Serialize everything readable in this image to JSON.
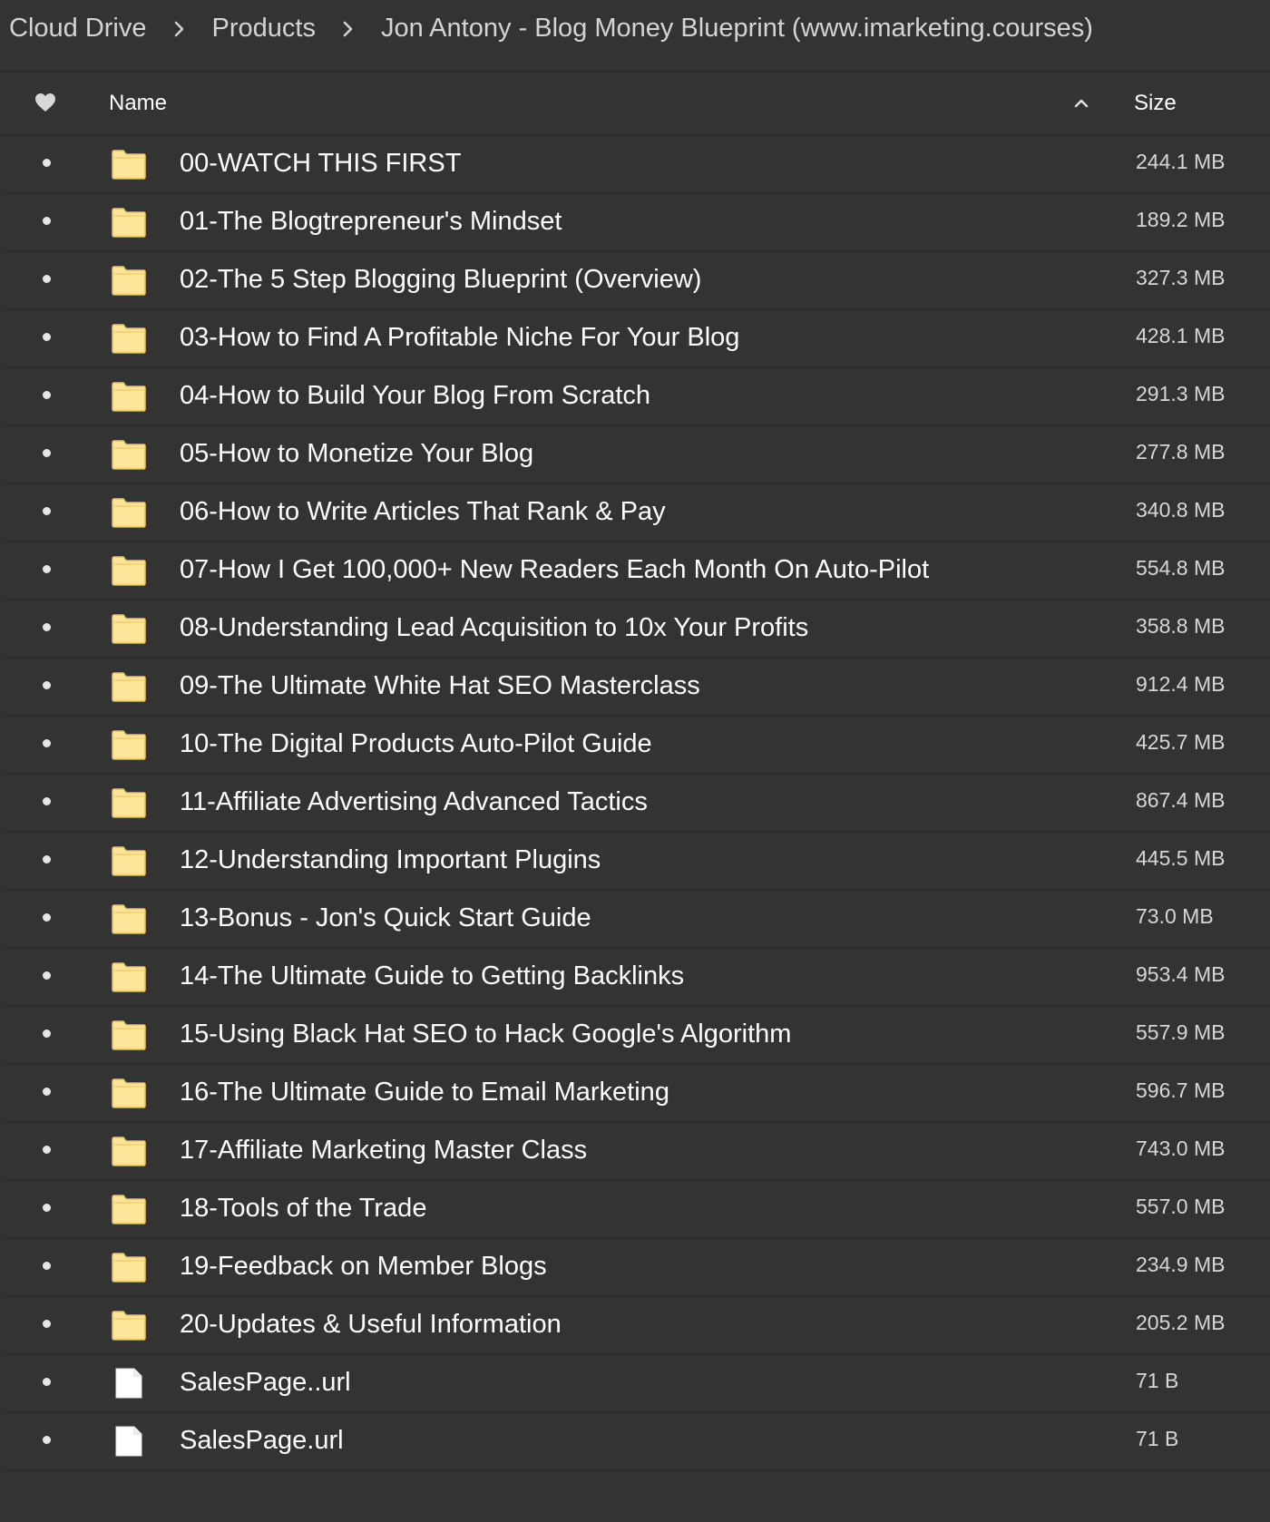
{
  "breadcrumb": {
    "items": [
      {
        "label": "Cloud Drive"
      },
      {
        "label": "Products"
      },
      {
        "label": "Jon Antony - Blog Money Blueprint (www.imarketing.courses)"
      }
    ]
  },
  "table": {
    "headers": {
      "favorite_icon": "heart-icon",
      "name": "Name",
      "sort_icon": "chevron-up-icon",
      "size": "Size"
    },
    "rows": [
      {
        "type": "folder",
        "name": "00-WATCH THIS FIRST",
        "size": "244.1 MB"
      },
      {
        "type": "folder",
        "name": "01-The Blogtrepreneur's Mindset",
        "size": "189.2 MB"
      },
      {
        "type": "folder",
        "name": "02-The 5 Step Blogging Blueprint (Overview)",
        "size": "327.3 MB"
      },
      {
        "type": "folder",
        "name": "03-How to Find A Profitable Niche For Your Blog",
        "size": "428.1 MB"
      },
      {
        "type": "folder",
        "name": "04-How to Build Your Blog From Scratch",
        "size": "291.3 MB"
      },
      {
        "type": "folder",
        "name": "05-How to Monetize Your Blog",
        "size": "277.8 MB"
      },
      {
        "type": "folder",
        "name": "06-How to Write Articles That Rank & Pay",
        "size": "340.8 MB"
      },
      {
        "type": "folder",
        "name": "07-How I Get 100,000+ New Readers Each Month On Auto-Pilot",
        "size": "554.8 MB"
      },
      {
        "type": "folder",
        "name": "08-Understanding Lead Acquisition to 10x Your Profits",
        "size": "358.8 MB"
      },
      {
        "type": "folder",
        "name": "09-The Ultimate White Hat SEO Masterclass",
        "size": "912.4 MB"
      },
      {
        "type": "folder",
        "name": "10-The Digital Products Auto-Pilot Guide",
        "size": "425.7 MB"
      },
      {
        "type": "folder",
        "name": "11-Affiliate Advertising Advanced Tactics",
        "size": "867.4 MB"
      },
      {
        "type": "folder",
        "name": "12-Understanding Important Plugins",
        "size": "445.5 MB"
      },
      {
        "type": "folder",
        "name": "13-Bonus - Jon's Quick Start Guide",
        "size": "73.0 MB"
      },
      {
        "type": "folder",
        "name": "14-The Ultimate Guide to Getting Backlinks",
        "size": "953.4 MB"
      },
      {
        "type": "folder",
        "name": "15-Using Black Hat SEO to Hack Google's Algorithm",
        "size": "557.9 MB"
      },
      {
        "type": "folder",
        "name": "16-The Ultimate Guide to Email Marketing",
        "size": "596.7 MB"
      },
      {
        "type": "folder",
        "name": "17-Affiliate Marketing Master Class",
        "size": "743.0 MB"
      },
      {
        "type": "folder",
        "name": "18-Tools of the Trade",
        "size": "557.0 MB"
      },
      {
        "type": "folder",
        "name": "19-Feedback on Member Blogs",
        "size": "234.9 MB"
      },
      {
        "type": "folder",
        "name": "20-Updates & Useful Information",
        "size": "205.2 MB"
      },
      {
        "type": "file",
        "name": "SalesPage..url",
        "size": "71 B"
      },
      {
        "type": "file",
        "name": "SalesPage.url",
        "size": "71 B"
      }
    ]
  },
  "colors": {
    "background": "#333333",
    "divider": "#2a2a2a",
    "folder_fill": "#fde59a",
    "folder_stroke": "#e8c060",
    "file_fill": "#ffffff"
  }
}
